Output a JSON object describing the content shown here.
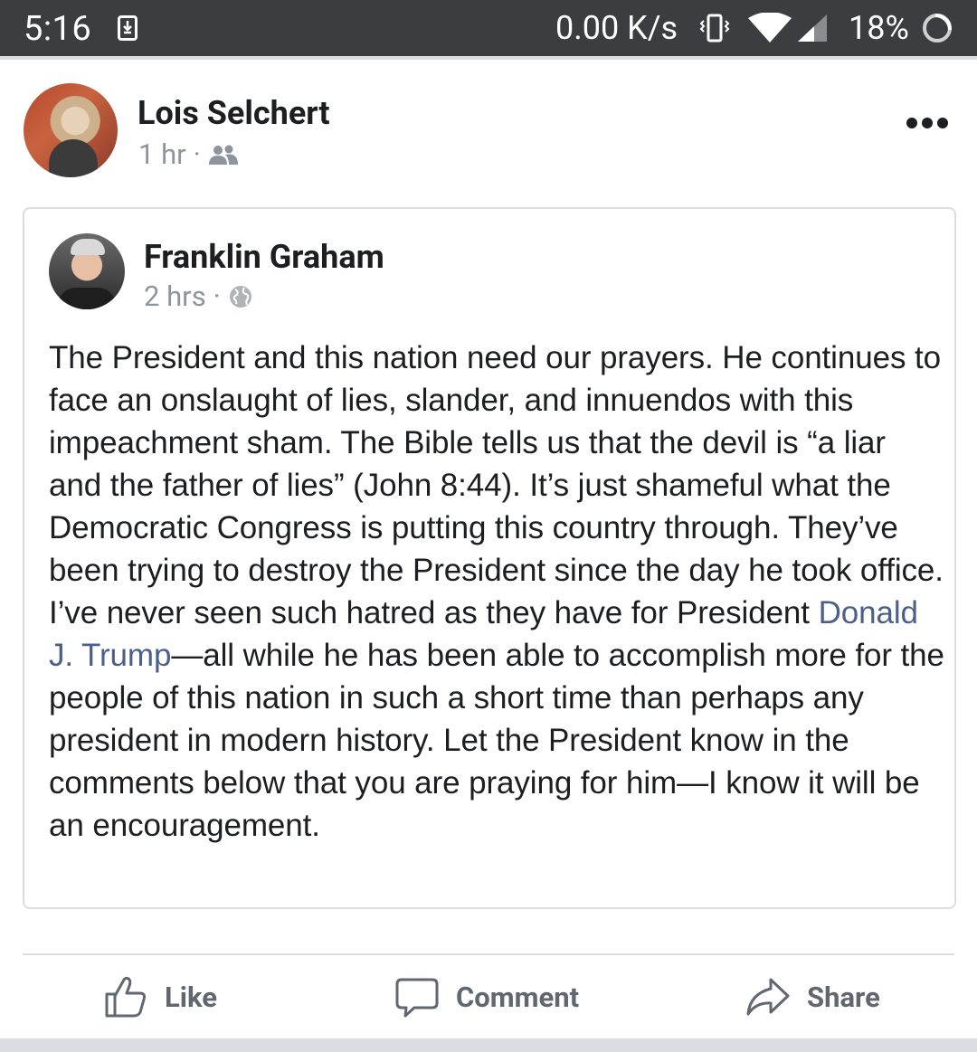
{
  "status_bar": {
    "time": "5:16",
    "network_speed": "0.00 K/s",
    "battery": "18%",
    "icons": [
      "download-icon",
      "vibrate-icon",
      "wifi-icon",
      "cell-signal-icon",
      "battery-ring-icon"
    ]
  },
  "post": {
    "author": "Lois Selchert",
    "time": "1 hr",
    "separator": "·",
    "audience_icon": "friends-icon",
    "more_icon": "more-options-icon"
  },
  "shared_post": {
    "author": "Franklin Graham",
    "time": "2 hrs",
    "separator": "·",
    "audience_icon": "globe-icon",
    "text_before_mention": "The President and this nation need our prayers. He continues to face an onslaught of lies, slander, and innuendos with this impeachment sham. The Bible tells us that the devil is “a liar and the father of lies” (John 8:44). It’s just shameful what the Democratic Congress is putting this country through. They’ve been trying to destroy the President since the day he took office. I’ve never seen such hatred as they have for President ",
    "mention": "Donald J. Trump",
    "text_after_mention": "—all while he has been able to accomplish more for the people of this nation in such a short time than perhaps any president in modern history. Let the President know in the comments below that you are praying for him—I know it will be an encouragement."
  },
  "actions": {
    "like_label": "Like",
    "comment_label": "Comment",
    "share_label": "Share"
  },
  "colors": {
    "status_bar": "#3b3d40",
    "mention": "#4b5f8a",
    "secondary_text": "#8d949e",
    "action_text": "#606770"
  }
}
